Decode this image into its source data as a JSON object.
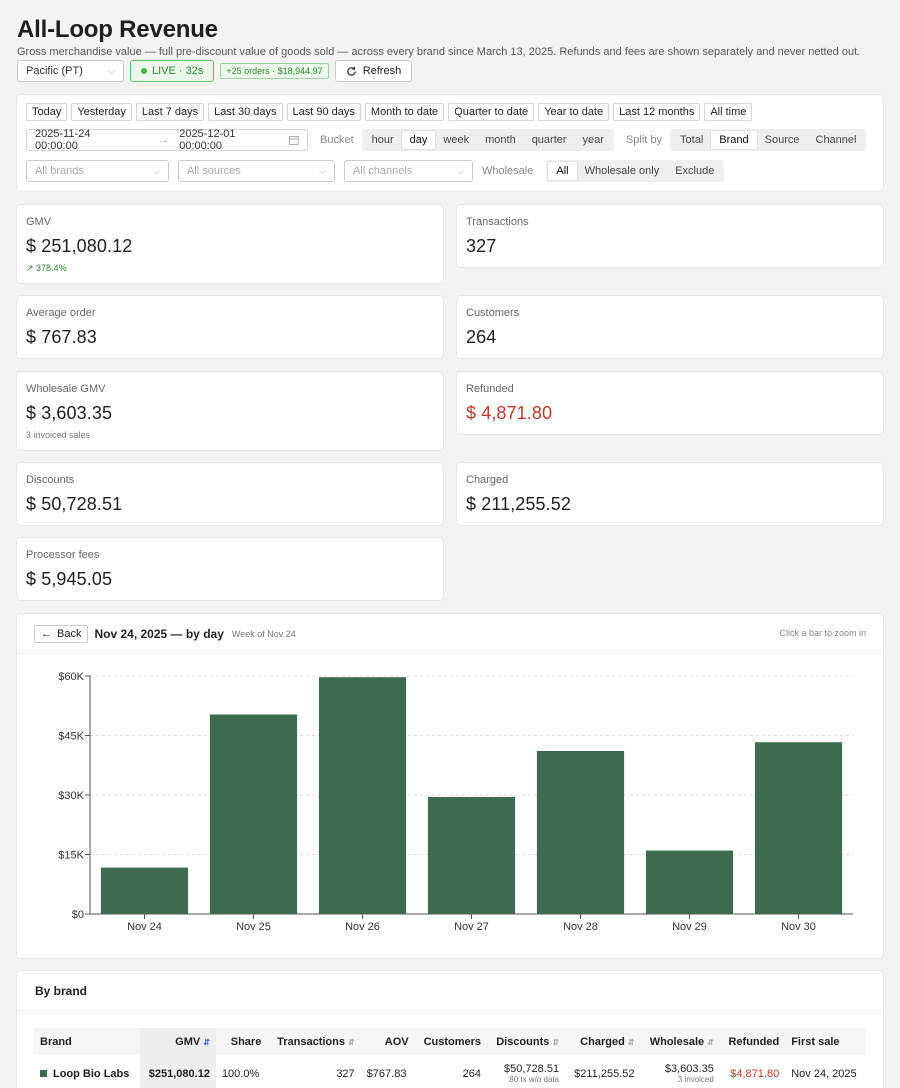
{
  "header": {
    "title": "All-Loop Revenue",
    "subtitle": "Gross merchandise value — full pre-discount value of goods sold — across every brand since March 13, 2025. Refunds and fees are shown separately and never netted out."
  },
  "controls": {
    "timezone": "Pacific (PT)",
    "live": "LIVE · 32s",
    "new_orders": "+25 orders · $18,944.97",
    "refresh": "Refresh"
  },
  "ranges": [
    "Today",
    "Yesterday",
    "Last 7 days",
    "Last 30 days",
    "Last 90 days",
    "Month to date",
    "Quarter to date",
    "Year to date",
    "Last 12 months",
    "All time"
  ],
  "date_range": {
    "start": "2025-11-24 00:00:00",
    "end": "2025-12-01 00:00:00"
  },
  "bucket": {
    "label": "Bucket",
    "options": [
      "hour",
      "day",
      "week",
      "month",
      "quarter",
      "year"
    ],
    "selected": "day"
  },
  "split": {
    "label": "Split by",
    "options": [
      "Total",
      "Brand",
      "Source",
      "Channel"
    ],
    "selected": "Brand"
  },
  "filters": {
    "brands": "All brands",
    "sources": "All sources",
    "channels": "All channels"
  },
  "wholesale": {
    "label": "Wholesale",
    "options": [
      "All",
      "Wholesale only",
      "Exclude"
    ],
    "selected": "All"
  },
  "metrics": {
    "gmv": {
      "label": "GMV",
      "value": "$ 251,080.12",
      "note": "378.4%"
    },
    "transactions": {
      "label": "Transactions",
      "value": "327"
    },
    "aov": {
      "label": "Average order",
      "value": "$ 767.83"
    },
    "customers": {
      "label": "Customers",
      "value": "264"
    },
    "wholesale": {
      "label": "Wholesale GMV",
      "value": "$ 3,603.35",
      "note": "3 invoiced sales"
    },
    "refunded": {
      "label": "Refunded",
      "value": "$ 4,871.80"
    },
    "discounts": {
      "label": "Discounts",
      "value": "$ 50,728.51"
    },
    "charged": {
      "label": "Charged",
      "value": "$ 211,255.52"
    },
    "fees": {
      "label": "Processor fees",
      "value": "$ 5,945.05"
    }
  },
  "chart_header": {
    "back": "Back",
    "title": "Nov 24, 2025 — by day",
    "week": "Week of Nov 24",
    "hint": "Click a bar to zoom in"
  },
  "chart_data": {
    "type": "bar",
    "categories": [
      "Nov 24",
      "Nov 25",
      "Nov 26",
      "Nov 27",
      "Nov 28",
      "Nov 29",
      "Nov 30"
    ],
    "values": [
      11700,
      50300,
      59700,
      29500,
      41100,
      16000,
      43300
    ],
    "yticks": [
      0,
      15000,
      30000,
      45000,
      60000
    ],
    "ytick_labels": [
      "$0",
      "$15K",
      "$30K",
      "$45K",
      "$60K"
    ],
    "ylim": [
      0,
      60000
    ],
    "color": "#3d6b4f",
    "grid": true
  },
  "brand_table": {
    "title": "By brand",
    "columns": [
      "Brand",
      "GMV",
      "Share",
      "Transactions",
      "AOV",
      "Customers",
      "Discounts",
      "Charged",
      "Wholesale",
      "Refunded",
      "First sale"
    ],
    "rows": [
      {
        "brand": "Loop Bio Labs",
        "gmv": "$251,080.12",
        "share": "100.0%",
        "transactions": "327",
        "aov": "$767.83",
        "customers": "264",
        "discounts": "$50,728.51",
        "discounts_note": "80 tx w/o data",
        "charged": "$211,255.52",
        "wholesale": "$3,603.35",
        "wholesale_note": "3 invoiced",
        "refunded": "$4,871.80",
        "first_sale": "Nov 24, 2025"
      }
    ]
  }
}
